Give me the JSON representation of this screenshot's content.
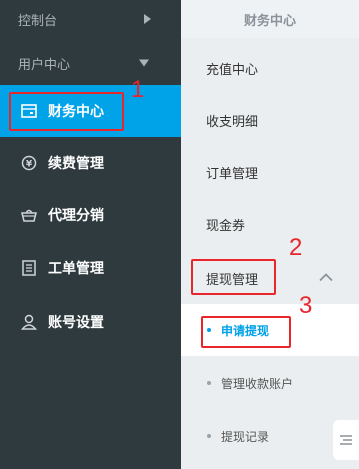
{
  "sidebar": {
    "top_items": [
      {
        "label": "控制台",
        "icon": "chevron-right-icon"
      },
      {
        "label": "用户中心",
        "icon": "chevron-down-icon"
      }
    ],
    "items": [
      {
        "label": "财务中心",
        "icon": "wallet-icon",
        "active": true
      },
      {
        "label": "续费管理",
        "icon": "yen-circle-icon"
      },
      {
        "label": "代理分销",
        "icon": "basket-icon"
      },
      {
        "label": "工单管理",
        "icon": "document-icon"
      },
      {
        "label": "账号设置",
        "icon": "user-icon"
      }
    ]
  },
  "panel": {
    "title": "财务中心",
    "items": [
      {
        "label": "充值中心"
      },
      {
        "label": "收支明细"
      },
      {
        "label": "订单管理"
      },
      {
        "label": "现金券"
      },
      {
        "label": "提现管理",
        "expanded": true,
        "icon": "chevron-up-icon"
      }
    ],
    "subitems": [
      {
        "label": "申请提现",
        "active": true
      },
      {
        "label": "管理收款账户"
      },
      {
        "label": "提现记录"
      }
    ]
  },
  "annotations": [
    "1",
    "2",
    "3"
  ],
  "colors": {
    "sidebar_bg": "#2f3a3f",
    "active_blue": "#00a2e8",
    "panel_bg": "#ebeef0",
    "annotation_red": "#e8262b"
  }
}
